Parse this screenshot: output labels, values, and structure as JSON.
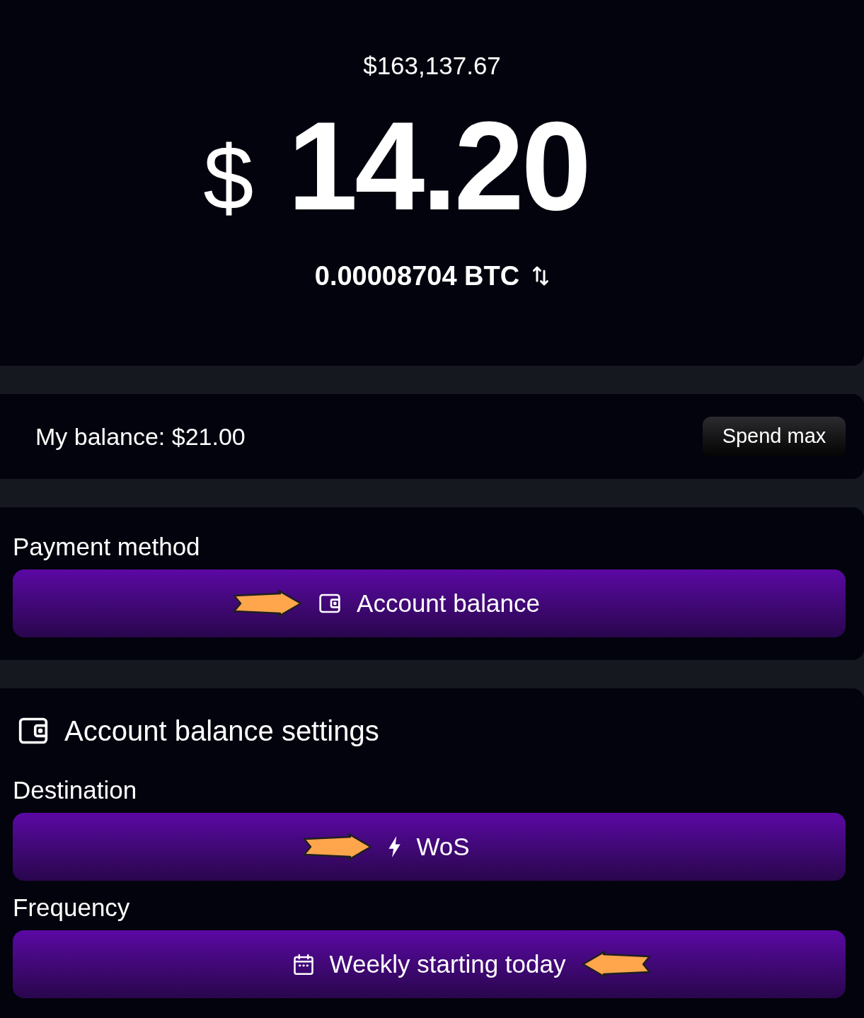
{
  "summary": {
    "total_fiat": "$163,137.67",
    "currency_symbol": "$",
    "amount": "14.20",
    "btc_amount": "0.00008704 BTC"
  },
  "balance": {
    "label": "My balance: $21.00",
    "button": "Spend max"
  },
  "payment_method": {
    "label": "Payment method",
    "option": {
      "label": "Account balance",
      "arrow_before": true,
      "arrow_after": false
    }
  },
  "settings": {
    "title": "Account balance settings",
    "fields": [
      {
        "label": "Destination",
        "value": "WoS",
        "arrow_before": true,
        "arrow_after": false
      },
      {
        "label": "Frequency",
        "value": "Weekly starting today",
        "arrow_before": false,
        "arrow_after": true
      }
    ]
  }
}
